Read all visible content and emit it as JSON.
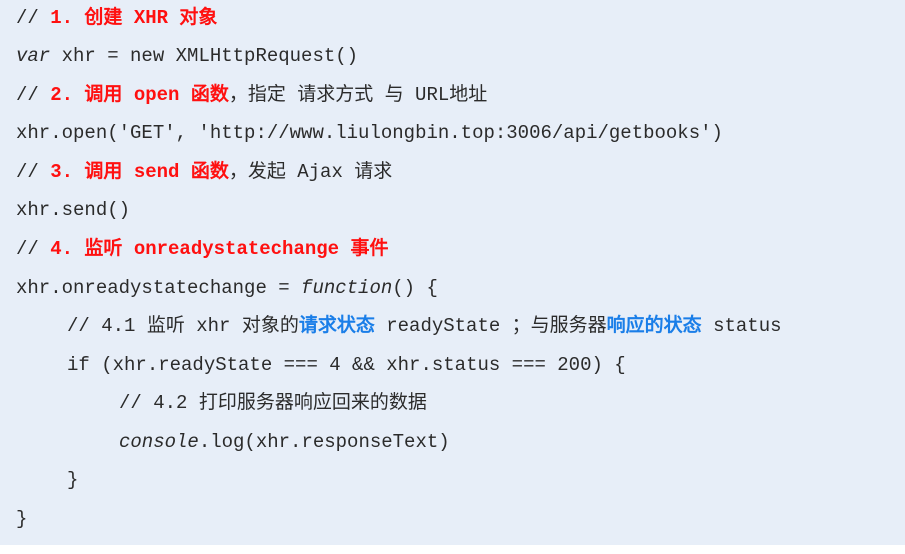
{
  "colors": {
    "background": "#e7eef8",
    "text": "#2b2b2b",
    "highlight_red": "#ff1010",
    "highlight_blue": "#1a7ee8"
  },
  "code": {
    "l1": {
      "prefix": "// ",
      "hl": "1. 创建 XHR 对象"
    },
    "l2": {
      "kw": "var",
      "rest": " xhr = new XMLHttpRequest()"
    },
    "l3": {
      "prefix": "// ",
      "hl": "2. 调用 open 函数",
      "rest": "，指定 请求方式 与 URL地址"
    },
    "l4": {
      "text": "xhr.open('GET', 'http://www.liulongbin.top:3006/api/getbooks')"
    },
    "l5": {
      "prefix": "// ",
      "hl": "3. 调用 send 函数",
      "rest": "，发起 Ajax 请求"
    },
    "l6": {
      "text": "xhr.send()"
    },
    "l7": {
      "prefix": "// ",
      "hl": "4. 监听 onreadystatechange 事件"
    },
    "l8": {
      "a": "xhr.onreadystatechange = ",
      "kw": "function",
      "b": "() {"
    },
    "l9": {
      "a": "// 4.1 监听 xhr 对象的",
      "hl1": "请求状态",
      "b": " readyState ；与服务器",
      "hl2": "响应的状态",
      "c": " status"
    },
    "l10": {
      "text": "if (xhr.readyState === 4 && xhr.status === 200) {"
    },
    "l11": {
      "text": "// 4.2 打印服务器响应回来的数据"
    },
    "l12": {
      "kw": "console",
      "rest": ".log(xhr.responseText)"
    },
    "l13": {
      "text": "}"
    },
    "l14": {
      "text": "}"
    }
  }
}
